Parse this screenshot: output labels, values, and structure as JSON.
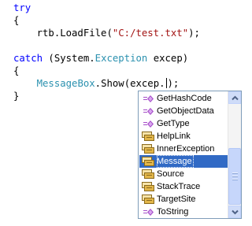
{
  "code": {
    "line1": {
      "keyword": "try"
    },
    "line2": {
      "text": "{"
    },
    "line3": {
      "before": "    rtb.LoadFile(",
      "string": "\"C:/test.txt\"",
      "after": ");"
    },
    "line4": {
      "keyword": "catch",
      "open": " (System.",
      "type": "Exception",
      "rest": " excep)"
    },
    "line5": {
      "text": "{"
    },
    "line6": {
      "indent": "    ",
      "type": "MessageBox",
      "before": ".Show(excep.",
      "after": ");"
    },
    "line7": {
      "text": "}"
    }
  },
  "intellisense": {
    "items": [
      {
        "label": "GetHashCode",
        "icon": "method-icon"
      },
      {
        "label": "GetObjectData",
        "icon": "method-icon"
      },
      {
        "label": "GetType",
        "icon": "method-icon"
      },
      {
        "label": "HelpLink",
        "icon": "property-icon"
      },
      {
        "label": "InnerException",
        "icon": "property-icon"
      },
      {
        "label": "Message",
        "icon": "property-icon",
        "selected": true
      },
      {
        "label": "Source",
        "icon": "property-icon"
      },
      {
        "label": "StackTrace",
        "icon": "property-icon"
      },
      {
        "label": "TargetSite",
        "icon": "property-icon"
      },
      {
        "label": "ToString",
        "icon": "method-icon"
      }
    ]
  },
  "colors": {
    "keyword": "#0000ff",
    "string": "#a31515",
    "type": "#2b91af",
    "selection": "#316ac5",
    "method_icon": "#a64ec8",
    "property_icon": "#d9a92b"
  }
}
